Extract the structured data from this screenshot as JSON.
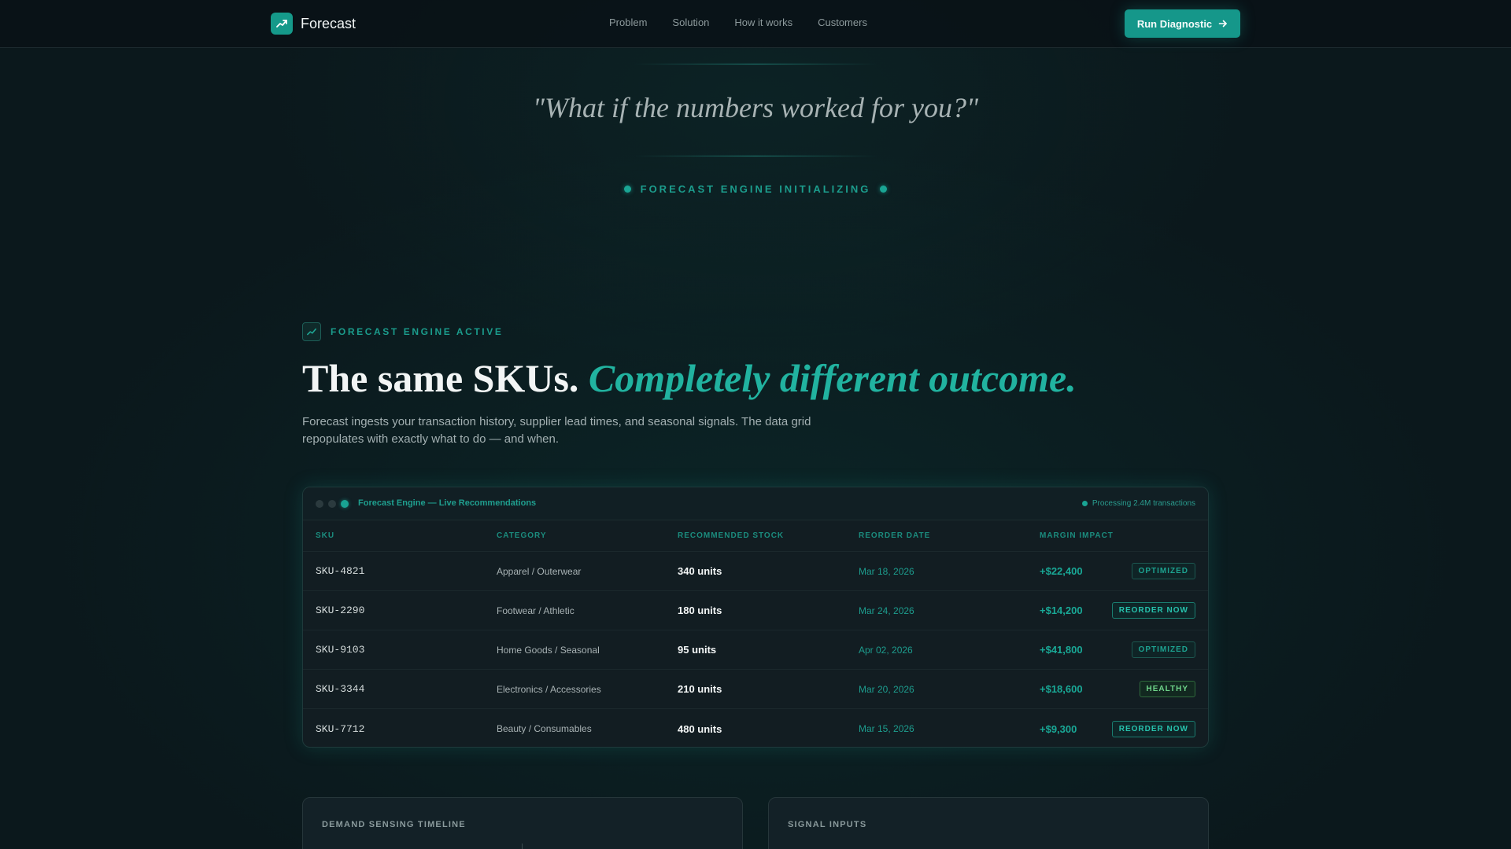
{
  "nav": {
    "brand": "Forecast",
    "links": [
      "Problem",
      "Solution",
      "How it works",
      "Customers"
    ],
    "cta_label": "Run Diagnostic"
  },
  "hero": {
    "quote": "\"What if the numbers worked for you?\"",
    "status": "FORECAST ENGINE INITIALIZING"
  },
  "section": {
    "eyebrow": "FORECAST ENGINE ACTIVE",
    "headline_plain": "The same SKUs.",
    "headline_accent": "Completely different outcome.",
    "lede": "Forecast ingests your transaction history, supplier lead times, and seasonal signals. The data grid repopulates with exactly what to do — and when."
  },
  "panel": {
    "title": "Forecast Engine — Live Recommendations",
    "processing": "Processing 2.4M transactions",
    "columns": [
      "SKU",
      "CATEGORY",
      "RECOMMENDED STOCK",
      "REORDER DATE",
      "MARGIN IMPACT"
    ],
    "rows": [
      {
        "sku": "SKU-4821",
        "category": "Apparel / Outerwear",
        "stock": "340 units",
        "date": "Mar 18, 2026",
        "margin": "+$22,400",
        "status": "OPTIMIZED"
      },
      {
        "sku": "SKU-2290",
        "category": "Footwear / Athletic",
        "stock": "180 units",
        "date": "Mar 24, 2026",
        "margin": "+$14,200",
        "status": "REORDER NOW"
      },
      {
        "sku": "SKU-9103",
        "category": "Home Goods / Seasonal",
        "stock": "95 units",
        "date": "Apr 02, 2026",
        "margin": "+$41,800",
        "status": "OPTIMIZED"
      },
      {
        "sku": "SKU-3344",
        "category": "Electronics / Accessories",
        "stock": "210 units",
        "date": "Mar 20, 2026",
        "margin": "+$18,600",
        "status": "HEALTHY"
      },
      {
        "sku": "SKU-7712",
        "category": "Beauty / Consumables",
        "stock": "480 units",
        "date": "Mar 15, 2026",
        "margin": "+$9,300",
        "status": "REORDER NOW"
      }
    ]
  },
  "cards": {
    "left_title": "DEMAND SENSING TIMELINE",
    "right_title": "SIGNAL INPUTS"
  },
  "colors": {
    "accent": "#15978a",
    "background": "#0b181c",
    "healthy": "#6fd48a"
  },
  "icons": {
    "brand": "trend-up-icon",
    "cta": "arrow-right-icon",
    "eyebrow": "trend-up-icon"
  }
}
